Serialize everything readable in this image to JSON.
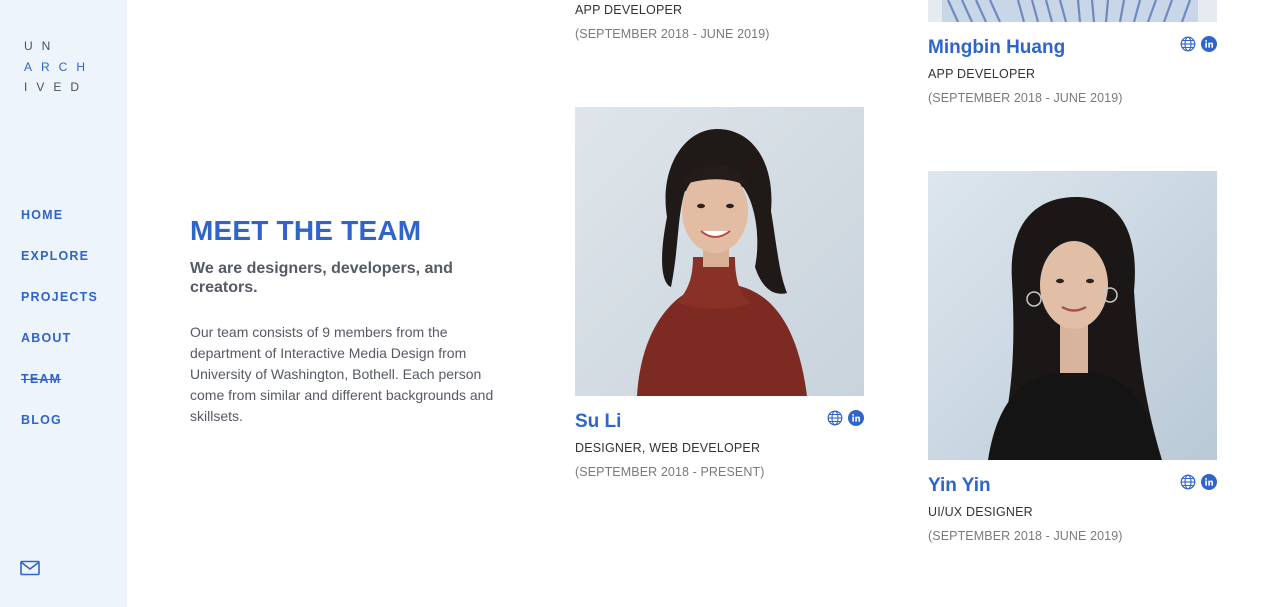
{
  "sidebar": {
    "logo": {
      "row1": "UN",
      "row2a": "ARCH",
      "row3": "IVED"
    },
    "nav": [
      "HOME",
      "EXPLORE",
      "PROJECTS",
      "ABOUT",
      "TEAM",
      "BLOG"
    ]
  },
  "intro": {
    "title": "MEET THE TEAM",
    "subtitle": "We are designers, developers, and creators.",
    "body": "Our team consists of 9 members from the department of Interactive Media Design from University of Washington, Bothell. Each person come from similar and different backgrounds and skillsets."
  },
  "members": [
    {
      "role": "APP DEVELOPER",
      "dates": "(SEPTEMBER 2018 - JUNE 2019)"
    },
    {
      "name": "Mingbin Huang",
      "role": "APP DEVELOPER",
      "dates": "(SEPTEMBER 2018 - JUNE 2019)"
    },
    {
      "name": "Su Li",
      "role": "DESIGNER, WEB DEVELOPER",
      "dates": "(SEPTEMBER 2018 - PRESENT)"
    },
    {
      "name": "Yin Yin",
      "role": "UI/UX DESIGNER",
      "dates": "(SEPTEMBER 2018 - JUNE 2019)"
    }
  ],
  "colors": {
    "accent": "#2e64cc",
    "sidebar_bg": "#eef4fc",
    "text": "#555a63"
  }
}
